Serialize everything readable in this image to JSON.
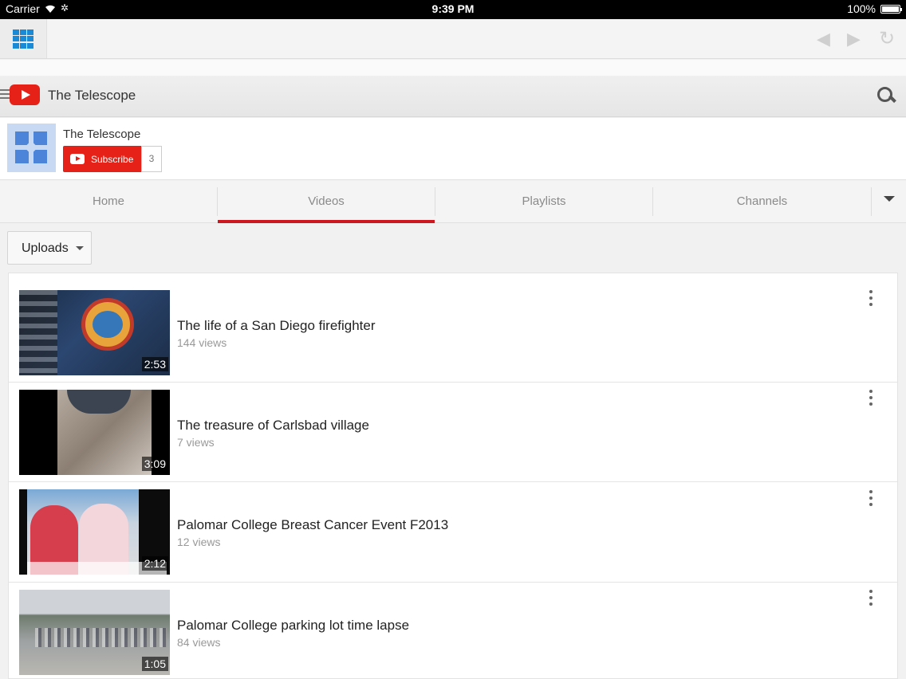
{
  "status_bar": {
    "carrier": "Carrier",
    "time": "9:39 PM",
    "battery": "100%"
  },
  "browser": {
    "apps_icon": "grid-icon",
    "back_icon": "back-arrow-icon",
    "forward_icon": "forward-arrow-icon",
    "reload_icon": "reload-icon"
  },
  "header": {
    "title": "The Telescope",
    "brand_color": "#e62117"
  },
  "channel": {
    "name": "The Telescope",
    "subscribe_label": "Subscribe",
    "subscriber_count": "3"
  },
  "tabs": [
    {
      "label": "Home",
      "active": false
    },
    {
      "label": "Videos",
      "active": true
    },
    {
      "label": "Playlists",
      "active": false
    },
    {
      "label": "Channels",
      "active": false
    }
  ],
  "filter": {
    "selected": "Uploads"
  },
  "videos": [
    {
      "title": "The life of a San Diego firefighter",
      "views": "144 views",
      "duration": "2:53"
    },
    {
      "title": "The treasure of Carlsbad village",
      "views": "7 views",
      "duration": "3:09"
    },
    {
      "title": "Palomar College Breast Cancer Event F2013",
      "views": "12 views",
      "duration": "2:12"
    },
    {
      "title": "Palomar College parking lot time lapse",
      "views": "84 views",
      "duration": "1:05"
    }
  ]
}
